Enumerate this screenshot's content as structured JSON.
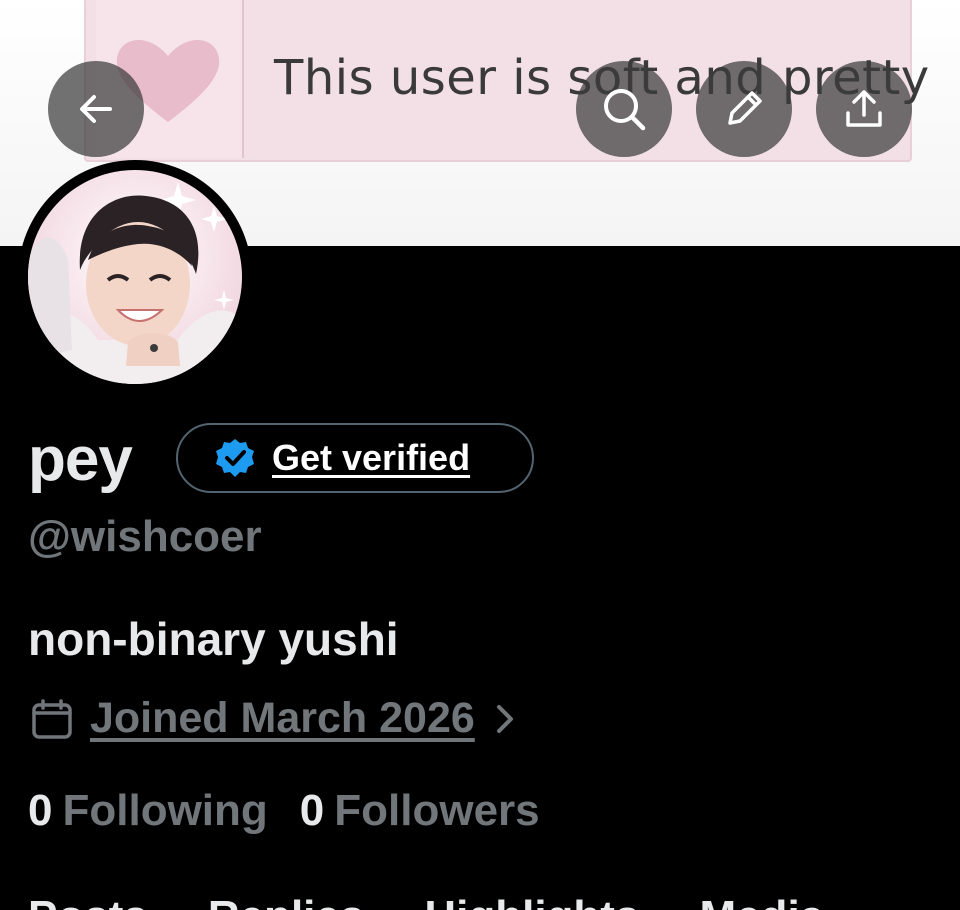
{
  "banner": {
    "text": "This user is soft and pretty"
  },
  "nav": {
    "back_icon": "arrow-left-icon",
    "search_icon": "search-icon",
    "edit_icon": "pencil-icon",
    "share_icon": "share-upload-icon"
  },
  "profile": {
    "display_name": "pey",
    "verify_label": "Get verified",
    "handle": "@wishcoer",
    "bio": "non-binary yushi",
    "joined": "Joined March 2026",
    "following_count": "0",
    "following_label": "Following",
    "followers_count": "0",
    "followers_label": "Followers"
  },
  "tabs": [
    "Posts",
    "Replies",
    "Highlights",
    "Media"
  ],
  "colors": {
    "background": "#000000",
    "text_primary": "#e7e9ea",
    "text_secondary": "#71767b",
    "verified_blue": "#1d9bf0",
    "button_overlay": "#3c3c3c"
  }
}
